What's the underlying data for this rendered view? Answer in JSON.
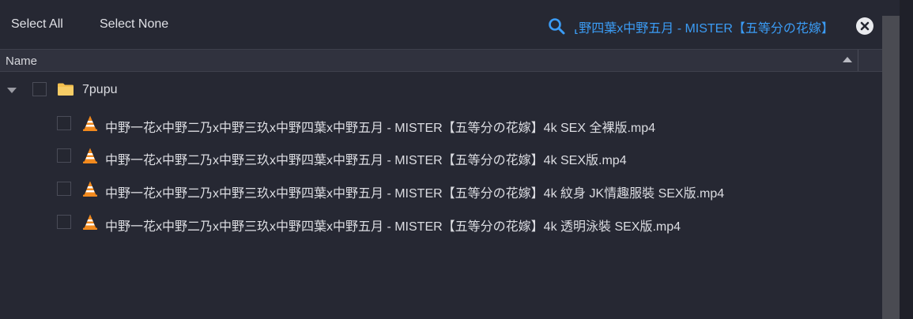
{
  "toolbar": {
    "select_all": "Select All",
    "select_none": "Select None",
    "search_value": "中野一花x中野二乃x中野三玖x中野四葉x中野五月 - MISTER【五等分の花嫁】",
    "search_visible": "⸤野四葉x中野五月 - MISTER【五等分の花嫁】",
    "search_icon": "search-icon",
    "clear_icon": "close-icon"
  },
  "columns": {
    "name": "Name",
    "sort": "ascending"
  },
  "tree": {
    "folder": {
      "label": "7pupu",
      "icon": "folder-icon",
      "expanded": true
    },
    "files": [
      {
        "label": "中野一花x中野二乃x中野三玖x中野四葉x中野五月 - MISTER【五等分の花嫁】4k SEX 全裸版.mp4",
        "icon": "vlc-icon"
      },
      {
        "label": "中野一花x中野二乃x中野三玖x中野四葉x中野五月 - MISTER【五等分の花嫁】4k SEX版.mp4",
        "icon": "vlc-icon"
      },
      {
        "label": "中野一花x中野二乃x中野三玖x中野四葉x中野五月 - MISTER【五等分の花嫁】4k 紋身 JK情趣服裝 SEX版.mp4",
        "icon": "vlc-icon"
      },
      {
        "label": "中野一花x中野二乃x中野三玖x中野四葉x中野五月 - MISTER【五等分の花嫁】4k 透明泳裝 SEX版.mp4",
        "icon": "vlc-icon"
      }
    ]
  },
  "colors": {
    "background": "#262833",
    "header": "#30323e",
    "accent": "#3b9cf5",
    "folder": "#f4c04e",
    "vlc_orange": "#f28a1e"
  }
}
